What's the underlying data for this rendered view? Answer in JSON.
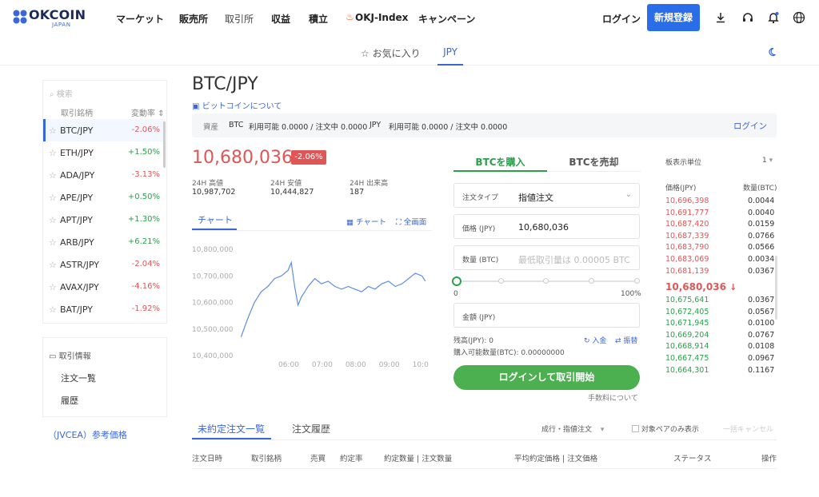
{
  "header": {
    "logo_text": "OKCOIN",
    "logo_sub": "JAPAN",
    "nav": [
      "マーケット",
      "販売所",
      "取引所",
      "収益",
      "積立",
      "OKJ-Index",
      "キャンペーン"
    ],
    "login": "ログイン",
    "signup": "新規登録"
  },
  "subtabs": {
    "favorites": "お気に入り",
    "jpy": "JPY"
  },
  "sidebar": {
    "search_placeholder": "検索",
    "col_symbol": "取引銘柄",
    "col_change": "変動率",
    "items": [
      {
        "symbol": "BTC/JPY",
        "change": "-2.06%"
      },
      {
        "symbol": "ETH/JPY",
        "change": "+1.50%"
      },
      {
        "symbol": "ADA/JPY",
        "change": "-3.13%"
      },
      {
        "symbol": "APE/JPY",
        "change": "+0.50%"
      },
      {
        "symbol": "APT/JPY",
        "change": "+1.30%"
      },
      {
        "symbol": "ARB/JPY",
        "change": "+6.21%"
      },
      {
        "symbol": "ASTR/JPY",
        "change": "-2.04%"
      },
      {
        "symbol": "AVAX/JPY",
        "change": "-4.16%"
      },
      {
        "symbol": "BAT/JPY",
        "change": "-1.92%"
      }
    ],
    "info_title": "取引情報",
    "order_list": "注文一覧",
    "history": "履歴",
    "jvcea": "（JVCEA）参考価格"
  },
  "main": {
    "pair": "BTC/JPY",
    "about": "ビットコインについて",
    "assets": {
      "label": "資産",
      "btc": "BTC",
      "btc_detail": "利用可能 0.0000 / 注文中 0.0000",
      "jpy": "JPY",
      "jpy_detail": "利用可能 0.0000 / 注文中 0.0000",
      "login": "ログイン"
    },
    "price": "10,680,036",
    "change_pct": "-2.06%",
    "stats": {
      "high_label": "24H 高値",
      "high": "10,987,702",
      "low_label": "24H 安値",
      "low": "10,444,827",
      "vol_label": "24H 出来高",
      "vol": "187"
    },
    "chart_tab": "チャート",
    "chart_tool": "チャート",
    "fullscreen": "全画面"
  },
  "chart_data": {
    "type": "line",
    "title": "",
    "xlabel": "",
    "ylabel": "",
    "x_ticks": [
      "06:00",
      "07:00",
      "08:00",
      "09:00",
      "10:0"
    ],
    "y_ticks": [
      "10,800,000",
      "10,700,000",
      "10,600,000",
      "10,500,000",
      "10,400,000"
    ],
    "ylim": [
      10400000,
      10800000
    ],
    "x_hours": [
      4.6,
      4.8,
      5.0,
      5.2,
      5.4,
      5.6,
      5.8,
      6.0,
      6.1,
      6.2,
      6.3,
      6.4,
      6.6,
      6.8,
      7.0,
      7.2,
      7.4,
      7.6,
      7.8,
      8.0,
      8.2,
      8.4,
      8.6,
      8.8,
      9.0,
      9.2,
      9.4,
      9.6,
      9.8,
      10.0,
      10.1
    ],
    "values": [
      10470000,
      10540000,
      10600000,
      10640000,
      10660000,
      10690000,
      10700000,
      10720000,
      10750000,
      10660000,
      10590000,
      10620000,
      10660000,
      10690000,
      10670000,
      10680000,
      10660000,
      10650000,
      10660000,
      10650000,
      10640000,
      10660000,
      10650000,
      10670000,
      10680000,
      10660000,
      10670000,
      10690000,
      10710000,
      10700000,
      10680000
    ]
  },
  "order_form": {
    "buy_tab": "BTCを購入",
    "sell_tab": "BTCを売却",
    "order_type_label": "注文タイプ",
    "order_type_value": "指値注文",
    "price_label": "価格 (JPY)",
    "price_value": "10,680,036",
    "qty_label": "数量 (BTC)",
    "qty_placeholder": "最低取引量は 0.00005 BTC",
    "slider_min": "0",
    "slider_max": "100%",
    "amount_label": "金額 (JPY)",
    "balance": "残高(JPY): 0",
    "deposit": "入金",
    "transfer": "振替",
    "buyable": "購入可能数量(BTC): 0.00000000",
    "trade_button": "ログインして取引開始",
    "fee_link": "手数料について"
  },
  "orderbook": {
    "unit_label": "板表示単位",
    "unit_value": "1",
    "col_price": "価格(JPY)",
    "col_qty": "数量(BTC)",
    "asks": [
      {
        "price": "10,696,398",
        "qty": "0.0044"
      },
      {
        "price": "10,691,777",
        "qty": "0.0040"
      },
      {
        "price": "10,687,420",
        "qty": "0.0159"
      },
      {
        "price": "10,687,339",
        "qty": "0.0766"
      },
      {
        "price": "10,683,790",
        "qty": "0.0566"
      },
      {
        "price": "10,683,069",
        "qty": "0.0034"
      },
      {
        "price": "10,681,139",
        "qty": "0.0367"
      }
    ],
    "last": "10,680,036",
    "bids": [
      {
        "price": "10,675,641",
        "qty": "0.0367"
      },
      {
        "price": "10,672,405",
        "qty": "0.0567"
      },
      {
        "price": "10,671,945",
        "qty": "0.0100"
      },
      {
        "price": "10,669,204",
        "qty": "0.0767"
      },
      {
        "price": "10,668,914",
        "qty": "0.0108"
      },
      {
        "price": "10,667,475",
        "qty": "0.0967"
      },
      {
        "price": "10,664,301",
        "qty": "0.1167"
      }
    ]
  },
  "orders": {
    "tab_open": "未約定注文一覧",
    "tab_history": "注文履歴",
    "filter": "成行・指値注文",
    "pair_only": "対象ペアのみ表示",
    "cancel_all": "一括キャンセル",
    "columns": [
      "注文日時",
      "取引銘柄",
      "売買",
      "約定率",
      "約定数量 | 注文数量",
      "平均約定価格 | 注文価格",
      "ステータス",
      "操作"
    ]
  }
}
